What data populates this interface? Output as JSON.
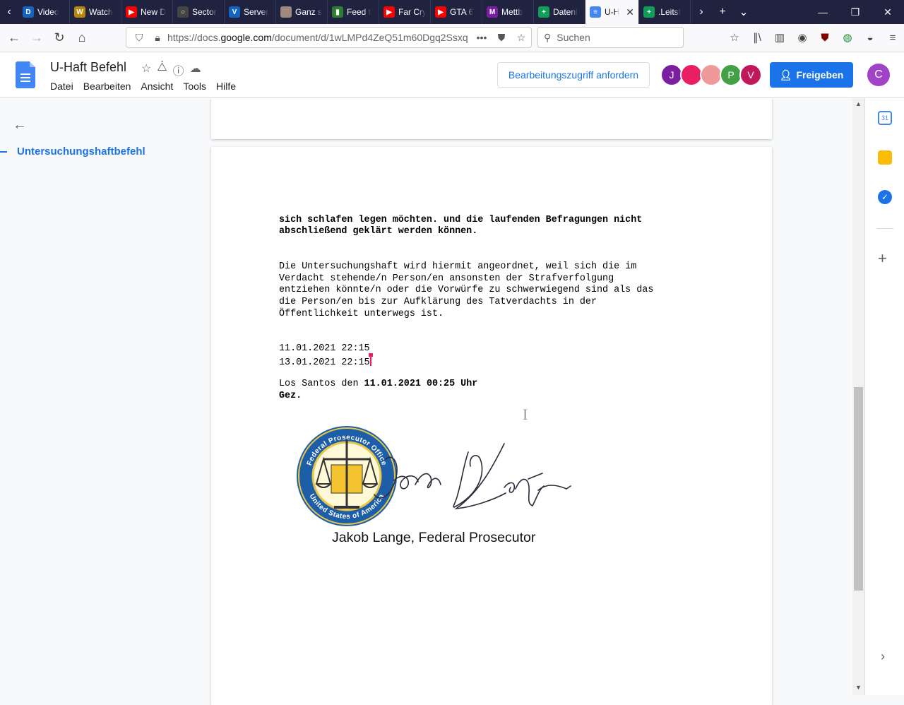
{
  "browser": {
    "tabs": [
      {
        "label": "Video",
        "color": "#1565c0",
        "glyph": "D"
      },
      {
        "label": "Watch",
        "color": "#b8860b",
        "glyph": "W"
      },
      {
        "label": "New D",
        "color": "#ff0000",
        "glyph": "▶"
      },
      {
        "label": "Sector",
        "color": "#444444",
        "glyph": "○"
      },
      {
        "label": "Server",
        "color": "#1565c0",
        "glyph": "V"
      },
      {
        "label": "Ganz s",
        "color": "#a1887f",
        "glyph": ""
      },
      {
        "label": "Feed t",
        "color": "#2e7d32",
        "glyph": "▮"
      },
      {
        "label": "Far Cry",
        "color": "#ff0000",
        "glyph": "▶"
      },
      {
        "label": "GTA 6",
        "color": "#ff0000",
        "glyph": "▶"
      },
      {
        "label": "Mettb",
        "color": "#7b1fa2",
        "glyph": "M"
      },
      {
        "label": "Datenl",
        "color": "#0f9d58",
        "glyph": "+"
      },
      {
        "label": "U-H",
        "color": "#4285f4",
        "glyph": "≡"
      },
      {
        "label": ".Leitst",
        "color": "#0f9d58",
        "glyph": "+"
      }
    ],
    "url_prefix": "https://docs.",
    "url_domain": "google.com",
    "url_rest": "/document/d/1wLMPd4ZeQ51m60Dgq2Ssxq",
    "search_placeholder": "Suchen"
  },
  "docs": {
    "title": "U-Haft Befehl",
    "menu": [
      "Datei",
      "Bearbeiten",
      "Ansicht",
      "Tools",
      "Hilfe"
    ],
    "request_access": "Bearbeitungszugriff anfordern",
    "share": "Freigeben",
    "user_initial": "C",
    "collaborators": [
      {
        "initial": "J",
        "color": "#7b1fa2"
      },
      {
        "initial": "",
        "color": "#e91e63"
      },
      {
        "initial": "",
        "color": "#ef9a9a"
      },
      {
        "initial": "P",
        "color": "#43a047"
      },
      {
        "initial": "V",
        "color": "#c2185b"
      }
    ]
  },
  "outline": {
    "heading": "Untersuchungshaftbefehl"
  },
  "document": {
    "para1_line1": "sich schlafen legen möchten. und die laufenden Befragungen nicht",
    "para1_line2": "abschließend geklärt werden können.",
    "para2_line1": "Die Untersuchungshaft wird hiermit angeordnet, weil sich die im",
    "para2_line2": "Verdacht stehende/n Person/en ansonsten der Strafverfolgung",
    "para2_line3": "entziehen könnte/n oder die Vorwürfe zu schwerwiegend sind als das",
    "para2_line4": "die Person/en bis zur Aufklärung des Tatverdachts in der",
    "para2_line5": "Öffentlichkeit unterwegs ist.",
    "time1": "11.01.2021 22:15",
    "time2": "13.01.2021 22:15",
    "place_prefix": "Los Santos den ",
    "place_date": "11.01.2021 00:25 Uhr",
    "gez": "Gez.",
    "seal_top_text": "Federal Prosecutor Office",
    "seal_bottom_text": "United States of America",
    "signature_caption": "Jakob Lange, Federal Prosecutor"
  }
}
